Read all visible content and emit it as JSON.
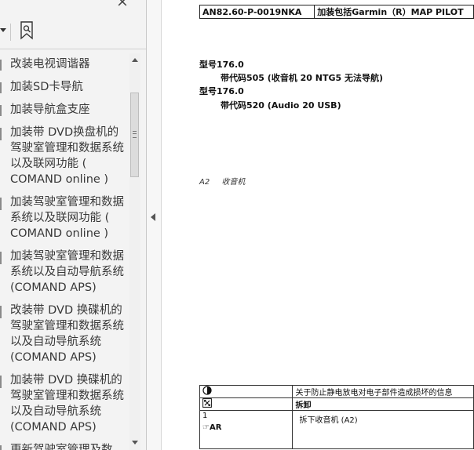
{
  "sidebar": {
    "close_glyph": "×",
    "icons": [
      "close-icon",
      "dropdown-arrow-icon",
      "bookmark-search-icon"
    ],
    "items": [
      {
        "label": "改装电视调谐器"
      },
      {
        "label": "加装SD卡导航"
      },
      {
        "label": "加装导航盒支座"
      },
      {
        "label": "加装带 DVD换盘机的驾驶室管理和数据系统以及联网功能 ( COMAND online )"
      },
      {
        "label": "加装驾驶室管理和数据系统以及联网功能 ( COMAND online )"
      },
      {
        "label": "加装驾驶室管理和数据系统以及自动导航系统 (COMAND APS)"
      },
      {
        "label": "改装带 DVD 换碟机的驾驶室管理和数据系统以及自动导航系统 (COMAND APS)"
      },
      {
        "label": "加装带 DVD 换碟机的驾驶室管理和数据系统以及自动导航系统 (COMAND APS)"
      },
      {
        "label": "更新驾驶室管理及数"
      }
    ]
  },
  "document": {
    "header": {
      "code": "AN82.60-P-0019NKA",
      "title": "加装包括Garmin（R）MAP PILOT"
    },
    "models": [
      {
        "label": "型号176.0",
        "detail": "带代码505 (收音机 20 NTG5 无法导航)"
      },
      {
        "label": "型号176.0",
        "detail": "带代码520 (Audio 20 USB)"
      }
    ],
    "legend": {
      "code": "A2",
      "text": "收音机"
    },
    "steps_table": {
      "rows": [
        {
          "icon": "esd-warning-icon",
          "text": "关于防止静电放电对电子部件造成损坏的信息"
        },
        {
          "icon": "removal-icon",
          "text": "拆卸",
          "bold": true
        },
        {
          "icon_number": "1",
          "icon_marker": "☞AR",
          "text": "拆下收音机 (A2)"
        }
      ]
    }
  }
}
